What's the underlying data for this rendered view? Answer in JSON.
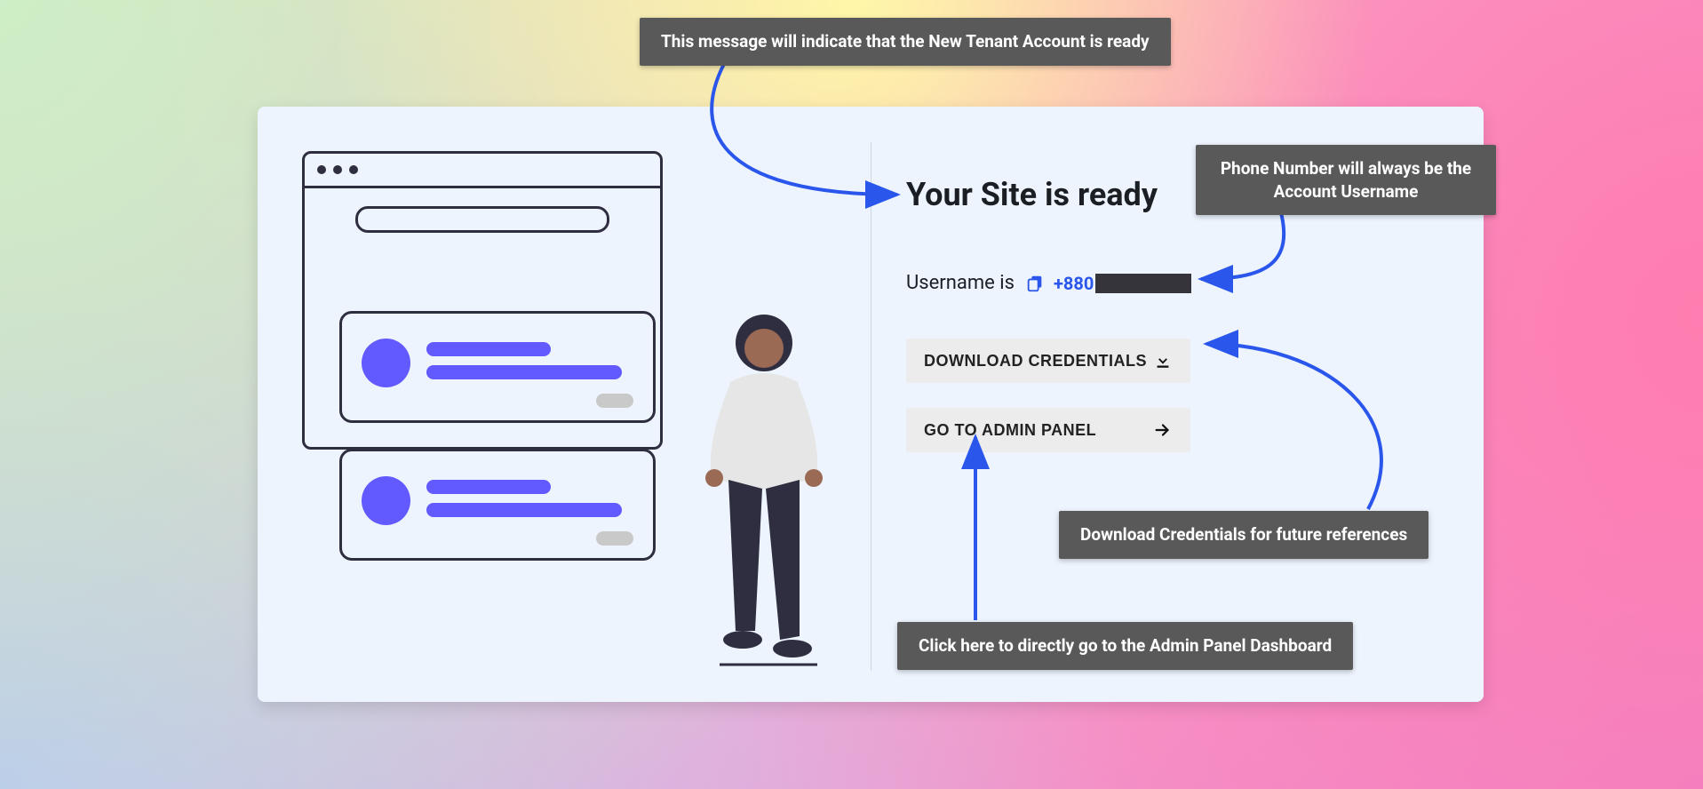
{
  "heading": "Your Site is ready",
  "username_label": "Username is",
  "username_prefix": "+880",
  "buttons": {
    "download": "DOWNLOAD CREDENTIALS",
    "admin": "GO TO ADMIN PANEL"
  },
  "callouts": {
    "ready": "This message will indicate that the New Tenant Account is ready",
    "phone": "Phone Number will always be the Account Username",
    "download": "Download Credentials for future references",
    "admin": "Click here to directly go to the Admin Panel Dashboard"
  }
}
